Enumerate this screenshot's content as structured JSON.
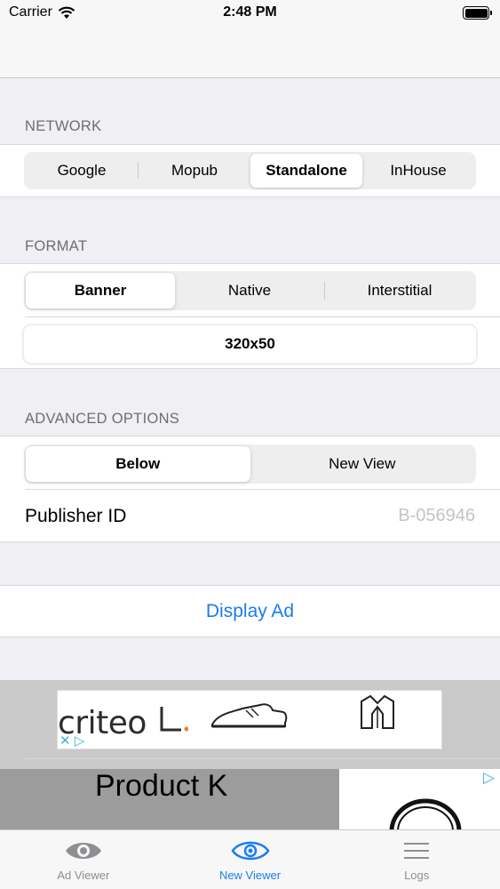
{
  "status_bar": {
    "carrier": "Carrier",
    "time": "2:48 PM"
  },
  "network": {
    "header": "NETWORK",
    "options": [
      "Google",
      "Mopub",
      "Standalone",
      "InHouse"
    ],
    "selected": "Standalone"
  },
  "format": {
    "header": "FORMAT",
    "options": [
      "Banner",
      "Native",
      "Interstitial"
    ],
    "selected": "Banner",
    "size": "320x50"
  },
  "advanced": {
    "header": "ADVANCED OPTIONS",
    "options": [
      "Below",
      "New View"
    ],
    "selected": "Below",
    "publisher_label": "Publisher ID",
    "publisher_placeholder": "B-056946"
  },
  "actions": {
    "display_ad": "Display Ad"
  },
  "ad": {
    "brand": "criteo",
    "close_glyph": "✕",
    "play_glyph": "▷",
    "native_title": "Product K"
  },
  "tab_bar": {
    "tabs": [
      {
        "label": "Ad Viewer",
        "icon": "eye-icon",
        "active": false
      },
      {
        "label": "New Viewer",
        "icon": "eye-icon",
        "active": true
      },
      {
        "label": "Logs",
        "icon": "list-icon",
        "active": false
      }
    ]
  },
  "colors": {
    "accent": "#1a7cf0",
    "criteo_orange": "#f47b20",
    "adchoices": "#34b3e4"
  }
}
